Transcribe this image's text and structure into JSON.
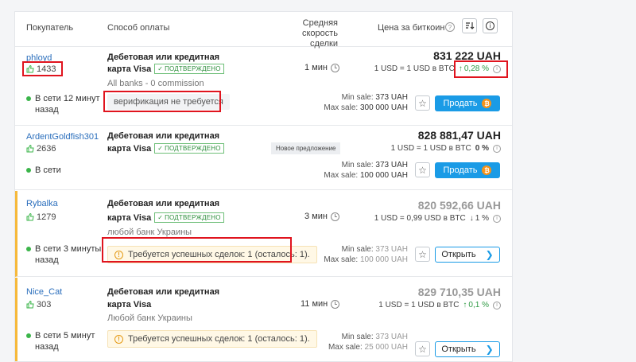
{
  "header": {
    "buyer": "Покупатель",
    "method": "Способ оплаты",
    "speed_line1": "Средняя скорость",
    "speed_line2": "сделки",
    "price": "Цена за биткоин"
  },
  "common": {
    "method_line1": "Дебетовая или кредитная",
    "method_line2": "карта Visa",
    "verified": "ПОДТВЕРЖДЕНО",
    "sell": "Продать",
    "open": "Открыть",
    "min_label": "Min sale:",
    "max_label": "Max sale:"
  },
  "offers": [
    {
      "name": "phloyd",
      "rating": "1433",
      "online_line1": "В сети 12 минут",
      "online_line2": "назад",
      "bank_desc": "All banks - 0 commission",
      "note": "верификация не требуется",
      "speed": "1 мин",
      "price": "831 222 UAH",
      "rate": "1 USD = 1 USD в BTC",
      "change": "0,28 %",
      "min": "373 UAH",
      "max": "300 000 UAH"
    },
    {
      "name": "ArdentGoldfish301",
      "rating": "2636",
      "online_line1": "В сети",
      "badge": "Новое предложение",
      "price": "828 881,47 UAH",
      "rate": "1 USD = 1 USD в BTC",
      "change": "0 %",
      "min": "373 UAH",
      "max": "100 000 UAH"
    },
    {
      "name": "Rybalka",
      "rating": "1279",
      "online_line1": "В сети 3 минуты",
      "online_line2": "назад",
      "bank_desc": "любой банк Украины",
      "note": "Требуется успешных сделок: 1 (осталось: 1).",
      "speed": "3 мин",
      "price": "820 592,66 UAH",
      "rate": "1 USD = 0,99 USD в BTC",
      "change": "1 %",
      "min": "373 UAH",
      "max": "100 000 UAH"
    },
    {
      "name": "Nice_Cat",
      "rating": "303",
      "online_line1": "В сети 5 минут",
      "online_line2": "назад",
      "bank_desc": "Любой банк Украины",
      "note": "Требуется успешных сделок: 1 (осталось: 1).",
      "speed": "11 мин",
      "price": "829 710,35 UAH",
      "rate": "1 USD = 1 USD в BTC",
      "change": "0,1 %",
      "min": "373 UAH",
      "max": "25 000 UAH"
    }
  ],
  "colors": {
    "accent": "#1a9be6",
    "highlight": "#e0141e",
    "online": "#3bb54a",
    "stripe": "#f6b93b"
  }
}
